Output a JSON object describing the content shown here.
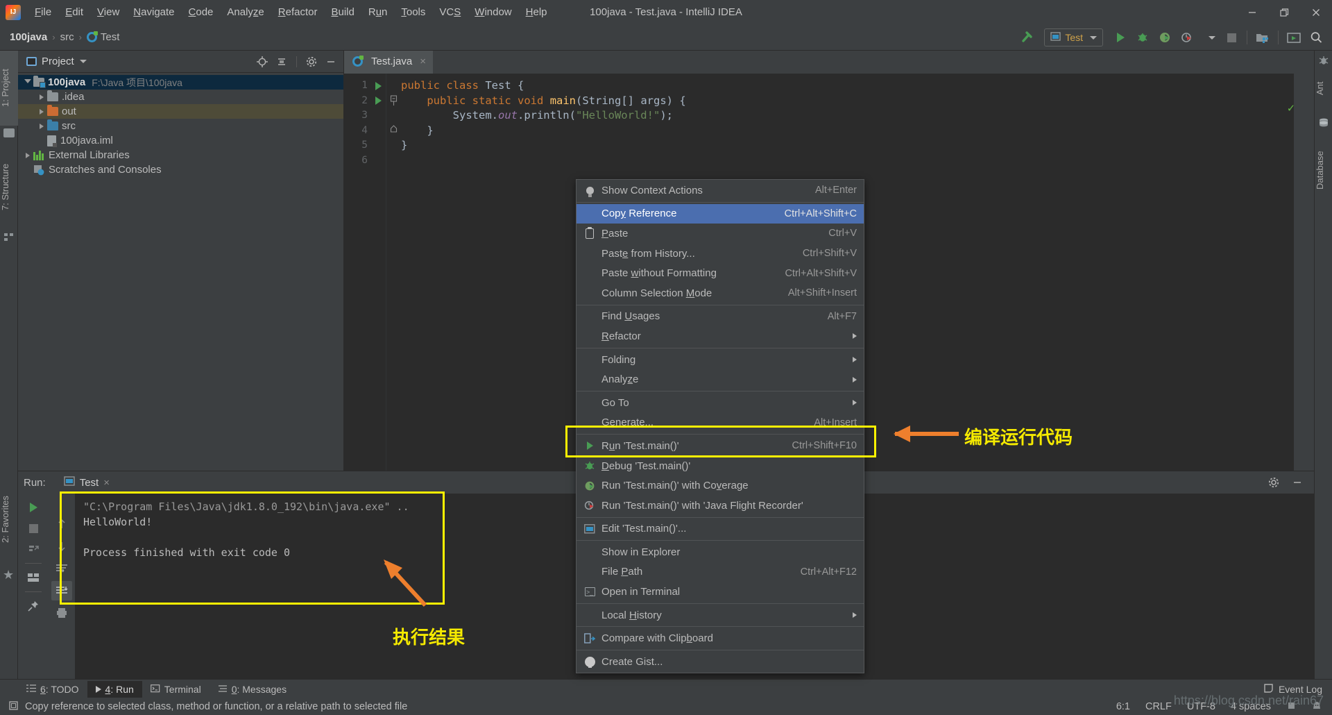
{
  "window": {
    "title": "100java - Test.java - IntelliJ IDEA",
    "logo_alt": "intellij-idea-logo",
    "minimize": "minimize-icon",
    "maximize": "restore-icon",
    "close": "close-icon"
  },
  "menubar": [
    {
      "label": "File",
      "mnemonic": "F"
    },
    {
      "label": "Edit",
      "mnemonic": "E"
    },
    {
      "label": "View",
      "mnemonic": "V"
    },
    {
      "label": "Navigate",
      "mnemonic": "N"
    },
    {
      "label": "Code",
      "mnemonic": "C"
    },
    {
      "label": "Analyze",
      "mnemonic": "z"
    },
    {
      "label": "Refactor",
      "mnemonic": "R"
    },
    {
      "label": "Build",
      "mnemonic": "B"
    },
    {
      "label": "Run",
      "mnemonic": "u"
    },
    {
      "label": "Tools",
      "mnemonic": "T"
    },
    {
      "label": "VCS",
      "mnemonic": "S"
    },
    {
      "label": "Window",
      "mnemonic": "W"
    },
    {
      "label": "Help",
      "mnemonic": "H"
    }
  ],
  "breadcrumb": {
    "project": "100java",
    "folder": "src",
    "file": "Test",
    "separator": "›"
  },
  "toolbar": {
    "build_icon": "hammer-icon",
    "run_config": "Test",
    "run_icon": "run-icon",
    "debug_icon": "debug-icon",
    "coverage_icon": "run-with-coverage-icon",
    "profiler_icon": "profiler-icon",
    "stop_icon": "stop-icon",
    "project_structure_icon": "project-structure-icon",
    "updates_icon": "updates-icon",
    "search_icon": "search-everywhere-icon"
  },
  "left_tabs": [
    {
      "label": "1: Project",
      "icon": "project-icon",
      "active": true
    },
    {
      "label": "7: Structure",
      "icon": "structure-icon",
      "active": false
    },
    {
      "label": "2: Favorites",
      "icon": "favorites-star-icon",
      "active": false
    }
  ],
  "right_tabs": [
    {
      "label": "Ant",
      "icon": "ant-icon"
    },
    {
      "label": "Database",
      "icon": "database-icon"
    }
  ],
  "project_panel": {
    "title": "Project",
    "icon": "project-view-icon",
    "dropdown_icon": "chevron-down-icon",
    "actions": [
      "locate-icon",
      "collapse-all-icon",
      "settings-gear-icon",
      "hide-icon"
    ],
    "tree": [
      {
        "label": "100java",
        "path": "F:\\Java 项目\\100java",
        "icon": "module-folder",
        "indent": 0,
        "expanded": true,
        "selected": true,
        "bold": true
      },
      {
        "label": ".idea",
        "path": "",
        "icon": "folder-grey",
        "indent": 1,
        "expanded": false,
        "selected": false,
        "bold": false
      },
      {
        "label": "out",
        "path": "",
        "icon": "folder-orange",
        "indent": 1,
        "expanded": false,
        "selected": false,
        "highlight": true,
        "bold": false
      },
      {
        "label": "src",
        "path": "",
        "icon": "folder-blue",
        "indent": 1,
        "expanded": false,
        "selected": false,
        "bold": false
      },
      {
        "label": "100java.iml",
        "path": "",
        "icon": "iml-file",
        "indent": 1,
        "leaf": true,
        "bold": false
      },
      {
        "label": "External Libraries",
        "path": "",
        "icon": "libraries-icon",
        "indent": 0,
        "expanded": false,
        "bold": false
      },
      {
        "label": "Scratches and Consoles",
        "path": "",
        "icon": "scratches-icon",
        "indent": 0,
        "leaf": true,
        "bold": false
      }
    ]
  },
  "editor": {
    "tab": {
      "label": "Test.java",
      "icon": "java-class-icon",
      "close": "×"
    },
    "inspection_ok": "✓",
    "lines": [
      {
        "num": "1",
        "gutter": "run-gutter-icon",
        "fold": "",
        "tokens": [
          {
            "t": "public",
            "c": "k"
          },
          {
            "t": " ",
            "c": "pl"
          },
          {
            "t": "class",
            "c": "k"
          },
          {
            "t": " Test {",
            "c": "pl"
          }
        ]
      },
      {
        "num": "2",
        "gutter": "run-gutter-icon",
        "fold": "fold-open",
        "tokens": [
          {
            "t": "    ",
            "c": "pl"
          },
          {
            "t": "public",
            "c": "k"
          },
          {
            "t": " ",
            "c": "pl"
          },
          {
            "t": "static",
            "c": "k"
          },
          {
            "t": " ",
            "c": "pl"
          },
          {
            "t": "void",
            "c": "k"
          },
          {
            "t": " ",
            "c": "pl"
          },
          {
            "t": "main",
            "c": "f"
          },
          {
            "t": "(String[] args) {",
            "c": "pl"
          }
        ]
      },
      {
        "num": "3",
        "gutter": "",
        "fold": "",
        "tokens": [
          {
            "t": "        System.",
            "c": "pl"
          },
          {
            "t": "out",
            "c": "sf"
          },
          {
            "t": ".println(",
            "c": "pl"
          },
          {
            "t": "\"HelloWorld!\"",
            "c": "s"
          },
          {
            "t": ");",
            "c": "pl"
          }
        ]
      },
      {
        "num": "4",
        "gutter": "",
        "fold": "fold-end",
        "tokens": [
          {
            "t": "    }",
            "c": "pl"
          }
        ]
      },
      {
        "num": "5",
        "gutter": "",
        "fold": "",
        "tokens": [
          {
            "t": "}",
            "c": "pl"
          }
        ]
      },
      {
        "num": "6",
        "gutter": "",
        "fold": "",
        "tokens": [
          {
            "t": "",
            "c": "pl"
          }
        ]
      }
    ]
  },
  "context_menu": [
    {
      "label": "Show Context Actions",
      "mnemonic": "",
      "shortcut": "Alt+Enter",
      "icon": "lightbulb-icon",
      "selected": false
    },
    {
      "sep": true
    },
    {
      "label": "Copy Reference",
      "mnemonic": "y",
      "shortcut": "Ctrl+Alt+Shift+C",
      "icon": "",
      "selected": true
    },
    {
      "label": "Paste",
      "mnemonic": "P",
      "shortcut": "Ctrl+V",
      "icon": "clipboard-icon",
      "selected": false
    },
    {
      "label": "Paste from History...",
      "mnemonic": "e",
      "shortcut": "Ctrl+Shift+V",
      "icon": "",
      "selected": false
    },
    {
      "label": "Paste without Formatting",
      "mnemonic": "w",
      "shortcut": "Ctrl+Alt+Shift+V",
      "icon": "",
      "selected": false
    },
    {
      "label": "Column Selection Mode",
      "mnemonic": "M",
      "shortcut": "Alt+Shift+Insert",
      "icon": "",
      "selected": false
    },
    {
      "sep": true
    },
    {
      "label": "Find Usages",
      "mnemonic": "U",
      "shortcut": "Alt+F7",
      "icon": "",
      "selected": false
    },
    {
      "label": "Refactor",
      "mnemonic": "R",
      "shortcut": "",
      "submenu": true,
      "icon": "",
      "selected": false
    },
    {
      "sep": true
    },
    {
      "label": "Folding",
      "mnemonic": "",
      "shortcut": "",
      "submenu": true,
      "icon": "",
      "selected": false
    },
    {
      "label": "Analyze",
      "mnemonic": "z",
      "shortcut": "",
      "submenu": true,
      "icon": "",
      "selected": false
    },
    {
      "sep": true
    },
    {
      "label": "Go To",
      "mnemonic": "",
      "shortcut": "",
      "submenu": true,
      "icon": "",
      "selected": false
    },
    {
      "label": "Generate...",
      "mnemonic": "G",
      "shortcut": "Alt+Insert",
      "icon": "",
      "selected": false
    },
    {
      "sep": true
    },
    {
      "label": "Run 'Test.main()'",
      "mnemonic": "u",
      "shortcut": "Ctrl+Shift+F10",
      "icon": "run-icon",
      "selected": false
    },
    {
      "label": "Debug 'Test.main()'",
      "mnemonic": "D",
      "shortcut": "",
      "icon": "debug-icon",
      "selected": false
    },
    {
      "label": "Run 'Test.main()' with Coverage",
      "mnemonic": "v",
      "shortcut": "",
      "icon": "coverage-icon",
      "selected": false
    },
    {
      "label": "Run 'Test.main()' with 'Java Flight Recorder'",
      "mnemonic": "",
      "shortcut": "",
      "icon": "jfr-icon",
      "selected": false
    },
    {
      "sep": true
    },
    {
      "label": "Edit 'Test.main()'...",
      "mnemonic": "",
      "shortcut": "",
      "icon": "edit-config-icon",
      "selected": false
    },
    {
      "sep": true
    },
    {
      "label": "Show in Explorer",
      "mnemonic": "",
      "shortcut": "",
      "icon": "",
      "selected": false
    },
    {
      "label": "File Path",
      "mnemonic": "P",
      "shortcut": "Ctrl+Alt+F12",
      "icon": "",
      "selected": false
    },
    {
      "label": "Open in Terminal",
      "mnemonic": "",
      "shortcut": "",
      "icon": "terminal-icon",
      "selected": false
    },
    {
      "sep": true
    },
    {
      "label": "Local History",
      "mnemonic": "H",
      "shortcut": "",
      "submenu": true,
      "icon": "",
      "selected": false
    },
    {
      "sep": true
    },
    {
      "label": "Compare with Clipboard",
      "mnemonic": "b",
      "shortcut": "",
      "icon": "compare-icon",
      "selected": false
    },
    {
      "sep": true
    },
    {
      "label": "Create Gist...",
      "mnemonic": "",
      "shortcut": "",
      "icon": "github-icon",
      "selected": false
    }
  ],
  "run_panel": {
    "label": "Run:",
    "tab": "Test",
    "tab_icon": "run-config-icon",
    "tab_close": "×",
    "settings_icon": "settings-gear-icon",
    "hide_icon": "hide-icon",
    "tools": [
      "rerun-icon",
      "stop-icon",
      "dump-threads-icon",
      "layout-icon",
      "pin-tab-icon"
    ],
    "tools2": [
      "up-arrow-icon",
      "down-arrow-icon",
      "soft-wrap-icon",
      "scroll-to-end-icon",
      "print-icon"
    ],
    "console": [
      {
        "text": "\"C:\\Program Files\\Java\\jdk1.8.0_192\\bin\\java.exe\" ..",
        "dim": true
      },
      {
        "text": "HelloWorld!",
        "dim": false
      },
      {
        "text": "",
        "dim": false
      },
      {
        "text": "Process finished with exit code 0",
        "dim": false
      }
    ]
  },
  "bottom_tabs": [
    {
      "label": "6: TODO",
      "mnemonic": "6",
      "icon": "todo-icon",
      "active": false
    },
    {
      "label": "4: Run",
      "mnemonic": "4",
      "icon": "run-icon",
      "active": true
    },
    {
      "label": "Terminal",
      "mnemonic": "",
      "icon": "terminal-icon",
      "active": false
    },
    {
      "label": "0: Messages",
      "mnemonic": "0",
      "icon": "messages-icon",
      "active": false
    }
  ],
  "bottom_right": {
    "event_log": "Event Log",
    "event_log_icon": "event-log-icon"
  },
  "statusbar": {
    "hint_icon": "copy-reference-icon",
    "hint": "Copy reference to selected class, method or function, or a relative path to selected file",
    "caret": "6:1",
    "line_sep": "CRLF",
    "encoding": "UTF-8",
    "indent": "4 spaces",
    "lock_icon": "lock-icon",
    "inspector_icon": "hector-icon"
  },
  "annotations": [
    {
      "text": "编译运行代码",
      "color": "#f5ea00",
      "name": "annotation-compile-run-code"
    },
    {
      "text": "执行结果",
      "color": "#f5ea00",
      "name": "annotation-execution-result"
    }
  ],
  "watermark": "https://blog.csdn.net/rain67",
  "colors": {
    "bg": "#3c3f41",
    "editor_bg": "#2b2b2b",
    "selection_blue": "#4b6eaf",
    "tree_selection": "#0d293e",
    "annotation_yellow": "#fff200",
    "arrow_orange": "#ee7f2d",
    "keyword": "#cc7832",
    "string": "#6a8759",
    "method": "#ffc66d",
    "static_field": "#9876aa"
  }
}
